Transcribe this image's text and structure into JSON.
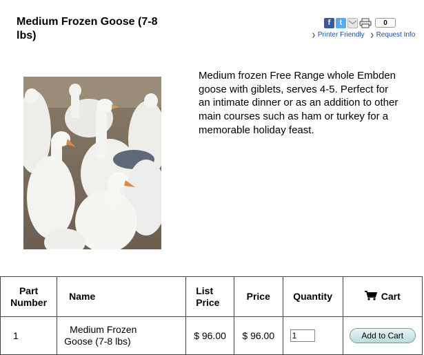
{
  "product": {
    "title": "Medium Frozen Goose (7-8 lbs)",
    "description": "Medium frozen Free Range whole Embden goose with giblets, serves 4-5. Perfect for an intimate dinner or as an addition to other main courses such as ham or turkey for a memorable holiday feast."
  },
  "share": {
    "facebook_glyph": "f",
    "twitter_glyph": "t",
    "count": "0"
  },
  "links": {
    "printer_friendly": "Printer Friendly",
    "request_info": "Request Info"
  },
  "table": {
    "headers": {
      "part_number": "Part Number",
      "name": "Name",
      "list_price": "List Price",
      "price": "Price",
      "quantity": "Quantity",
      "cart": "Cart"
    },
    "row": {
      "part_number": "1",
      "name": "Medium Frozen Goose (7-8 lbs)",
      "list_price": "$ 96.00",
      "price": "$ 96.00",
      "quantity": "1",
      "add_button": "Add to Cart"
    }
  }
}
